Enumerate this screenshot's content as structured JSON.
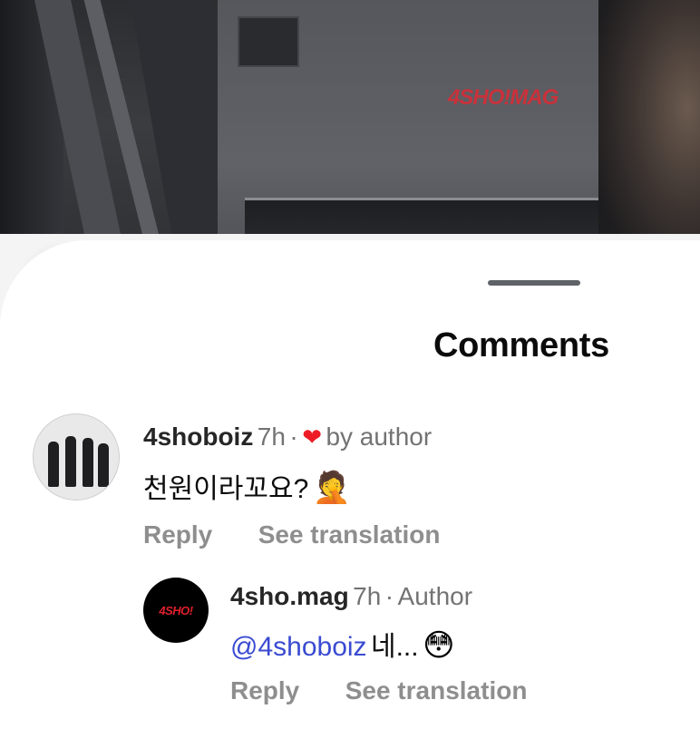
{
  "background": {
    "brand_text": "4SHO!MAG"
  },
  "sheet": {
    "title": "Comments"
  },
  "comments": [
    {
      "username": "4shoboiz",
      "time": "7h",
      "separator": "·",
      "liked_by_author_label": "by author",
      "text": "천원이라꼬요?",
      "emoji": "🤦",
      "reply_label": "Reply",
      "see_translation_label": "See translation",
      "avatar_icon": "crew-photo-avatar"
    }
  ],
  "replies": [
    {
      "username": "4sho.mag",
      "time": "7h",
      "separator": "·",
      "role_badge": "Author",
      "mention": "@4shoboiz",
      "text": "네...",
      "emoji": "😳",
      "reply_label": "Reply",
      "see_translation_label": "See translation",
      "avatar_text": "4SHO!"
    }
  ],
  "colors": {
    "heart": "#ed1c24",
    "mention": "#3a4bd1",
    "brand_red": "#e0202c"
  }
}
